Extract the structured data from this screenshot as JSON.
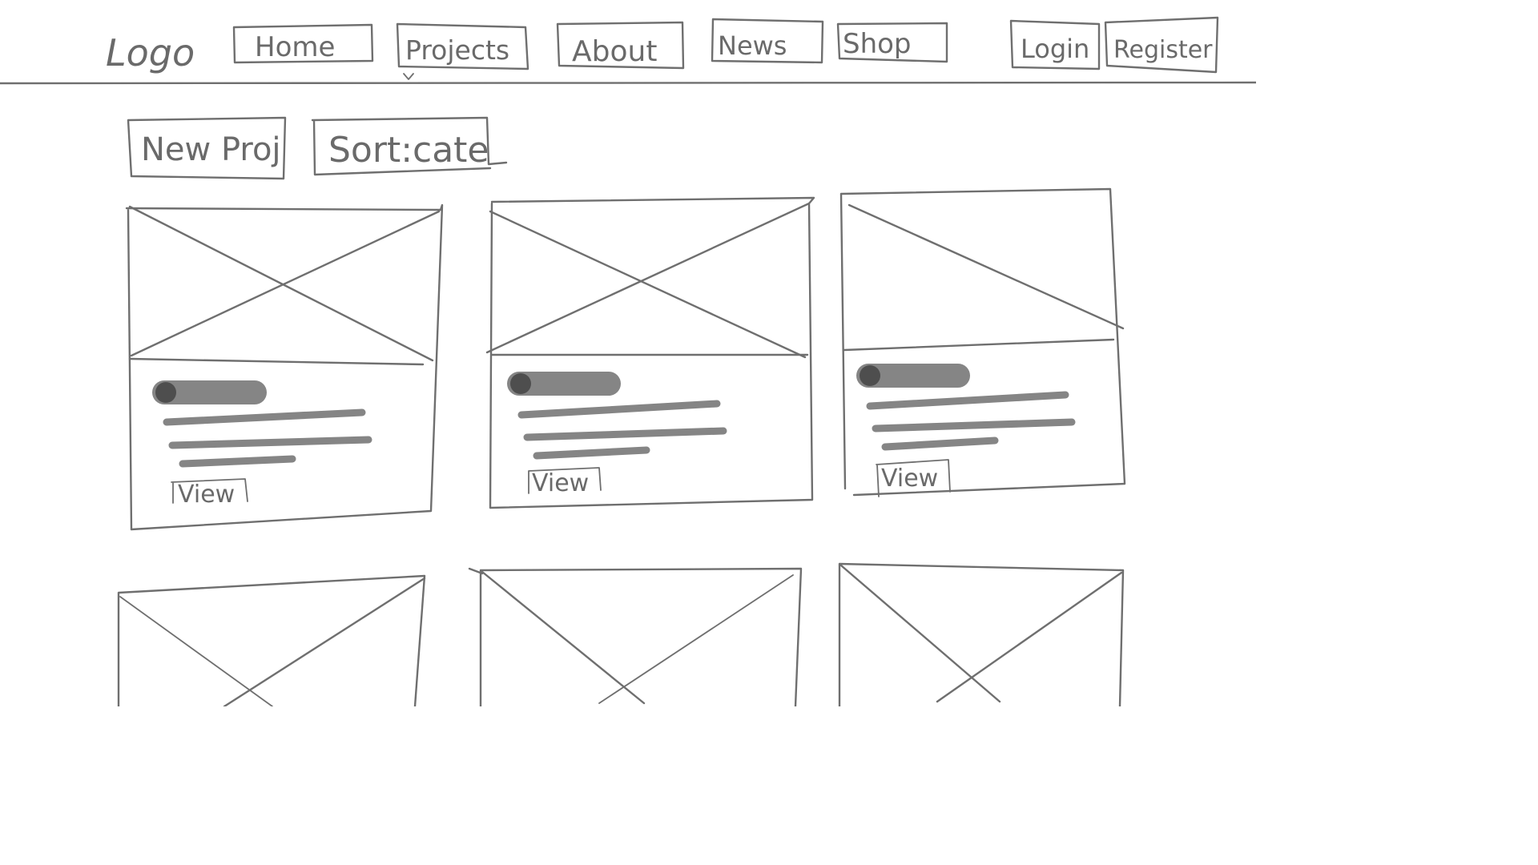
{
  "nav": {
    "logo": "Logo",
    "items": [
      "Home",
      "Projects",
      "About",
      "News",
      "Shop"
    ],
    "login": "Login",
    "register": "Register"
  },
  "toolbar": {
    "new_project": "New Proj",
    "sort": "Sort:cate"
  },
  "cards": [
    {
      "link": "View"
    },
    {
      "link": "View"
    },
    {
      "link": "View"
    }
  ],
  "colors": {
    "line": "#6f6f6f",
    "placeholder_bar": "#858585",
    "avatar": "#4e4e4e"
  }
}
